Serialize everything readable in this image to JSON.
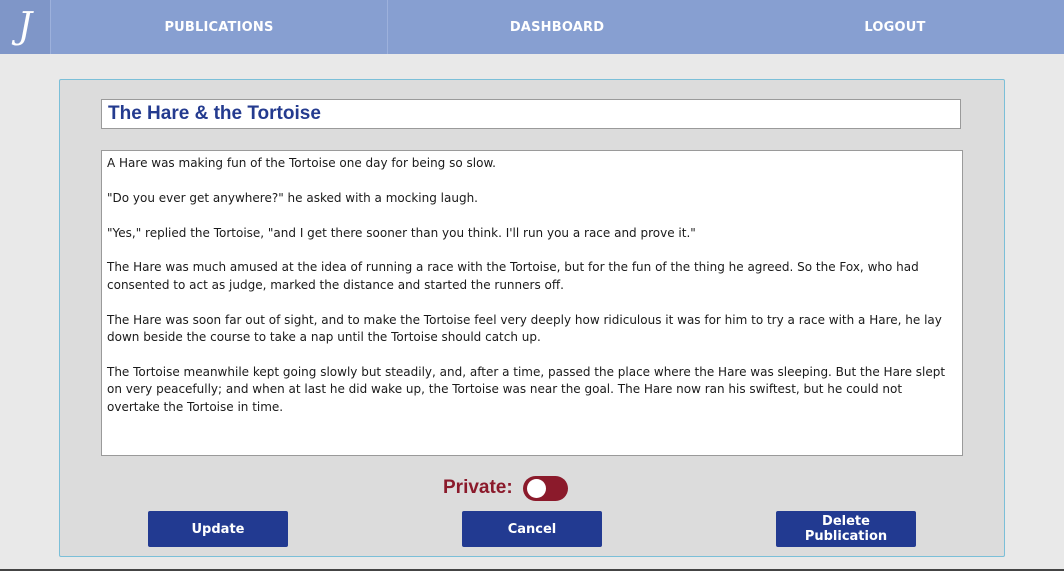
{
  "nav": {
    "logo_letter": "J",
    "items": [
      {
        "label": "PUBLICATIONS"
      },
      {
        "label": "DASHBOARD"
      },
      {
        "label": "LOGOUT"
      }
    ]
  },
  "publication": {
    "title": "The Hare & the Tortoise",
    "paragraphs": [
      "A Hare was making fun of the Tortoise one day for being so slow.",
      "\"Do you ever get anywhere?\" he asked with a mocking laugh.",
      "\"Yes,\" replied the Tortoise, \"and I get there sooner than you think. I'll run you a race and prove it.\"",
      "The Hare was much amused at the idea of running a race with the Tortoise, but for the fun of the thing he agreed. So the Fox, who had consented to act as judge, marked the distance and started the runners off.",
      "The Hare was soon far out of sight, and to make the Tortoise feel very deeply how ridiculous it was for him to try a race with a Hare, he lay down beside the course to take a nap until the Tortoise should catch up.",
      "The Tortoise meanwhile kept going slowly but steadily, and, after a time, passed the place where the Hare was sleeping. But the Hare slept on very peacefully; and when at last he did wake up, the Tortoise was near the goal. The Hare now ran his swiftest, but he could not overtake the Tortoise in time."
    ]
  },
  "private": {
    "label": "Private:",
    "enabled": false
  },
  "actions": {
    "update_label": "Update",
    "cancel_label": "Cancel",
    "delete_label": "Delete Publication"
  },
  "colors": {
    "nav_bg": "#879fd1",
    "primary_button": "#223a91",
    "title_text": "#243b8f",
    "private_accent": "#8b1a2b"
  }
}
